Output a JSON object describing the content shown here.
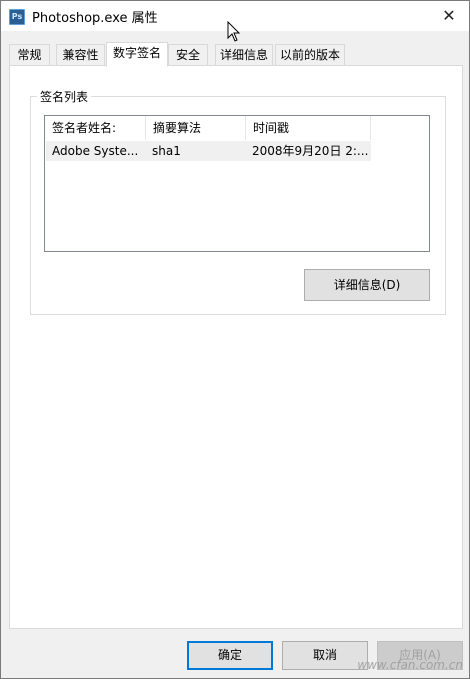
{
  "window": {
    "title": "Photoshop.exe 属性",
    "icon": "photoshop-app-icon",
    "icon_text": "Ps",
    "close_label": "✕"
  },
  "tabs": [
    {
      "label": "常规",
      "active": false
    },
    {
      "label": "兼容性",
      "active": false
    },
    {
      "label": "数字签名",
      "active": true
    },
    {
      "label": "安全",
      "active": false
    },
    {
      "label": "详细信息",
      "active": false
    },
    {
      "label": "以前的版本",
      "active": false
    }
  ],
  "signature_list": {
    "group_label": "签名列表",
    "columns": [
      "签名者姓名:",
      "摘要算法",
      "时间戳"
    ],
    "rows": [
      {
        "signer": "Adobe Syste...",
        "digest": "sha1",
        "timestamp": "2008年9月20日 2:..."
      }
    ],
    "details_button": "详细信息(D)"
  },
  "footer": {
    "ok": "确定",
    "cancel": "取消",
    "apply": "应用(A)"
  },
  "watermark": "www.cfan.com.cn",
  "colors": {
    "accent": "#0078d7",
    "panel_bg": "#ffffff",
    "window_bg": "#f0f0f0"
  }
}
